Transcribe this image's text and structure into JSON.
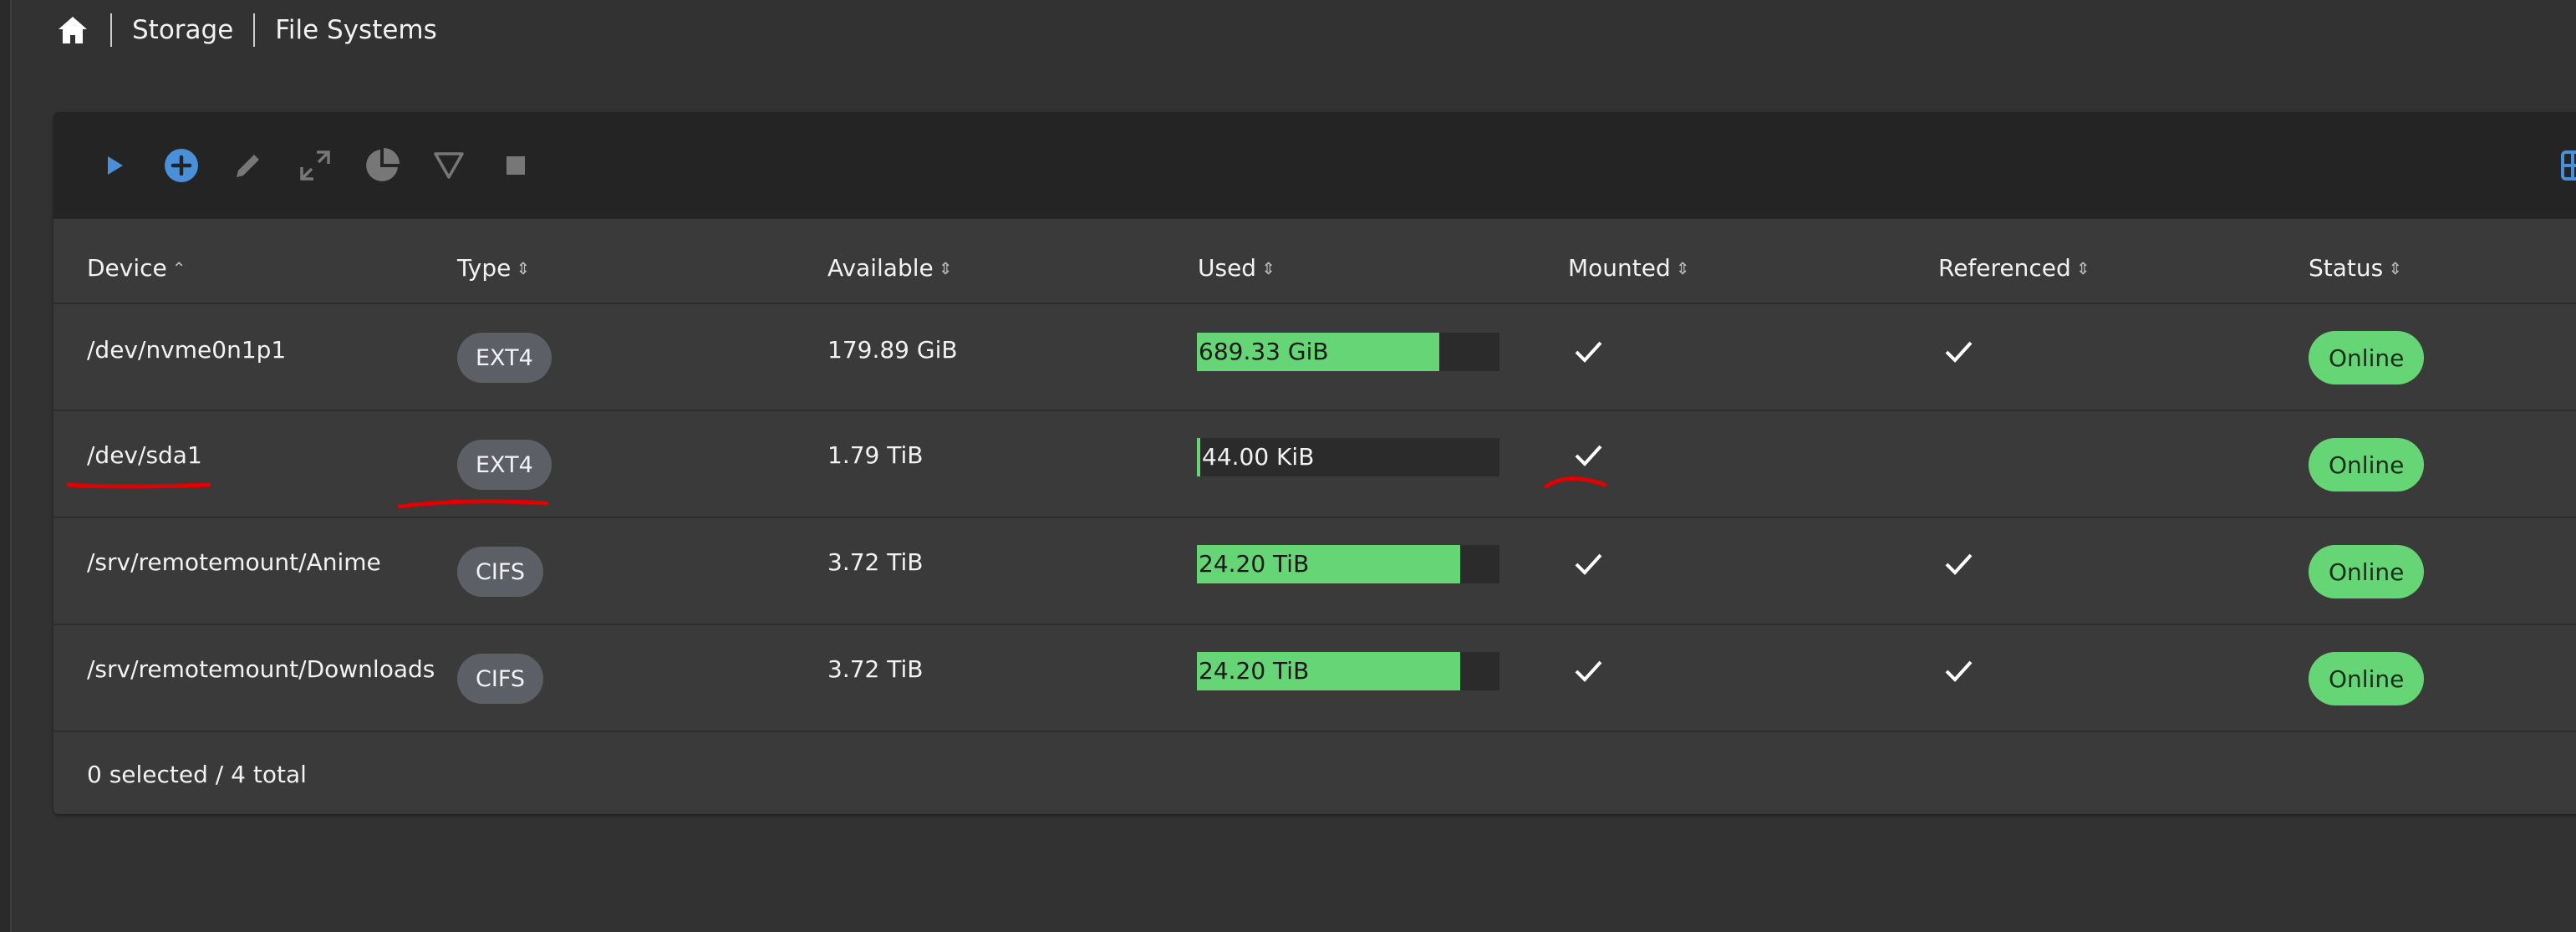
{
  "breadcrumb": {
    "home_icon": "home-icon",
    "items": [
      "Storage",
      "File Systems"
    ]
  },
  "toolbar": {
    "icons": [
      "play-icon",
      "add-circle-icon",
      "edit-icon",
      "expand-icon",
      "pie-chart-icon",
      "filter-icon",
      "stop-icon",
      "table-columns-icon"
    ],
    "accent": "#4a90d9"
  },
  "table": {
    "columns": [
      "Device",
      "Type",
      "Available",
      "Used",
      "Mounted",
      "Referenced",
      "Status"
    ],
    "rows": [
      {
        "device": "/dev/nvme0n1p1",
        "type": "EXT4",
        "available": "179.89 GiB",
        "used": "689.33 GiB",
        "used_fraction": 0.8,
        "mounted": true,
        "referenced": true,
        "status": "Online"
      },
      {
        "device": "/dev/sda1",
        "type": "EXT4",
        "available": "1.79 TiB",
        "used": "44.00 KiB",
        "used_fraction": 0.0,
        "mounted": true,
        "referenced": false,
        "status": "Online"
      },
      {
        "device": "/srv/remotemount/Anime",
        "type": "CIFS",
        "available": "3.72 TiB",
        "used": "24.20 TiB",
        "used_fraction": 0.87,
        "mounted": true,
        "referenced": true,
        "status": "Online"
      },
      {
        "device": "/srv/remotemount/Downloads",
        "type": "CIFS",
        "available": "3.72 TiB",
        "used": "24.20 TiB",
        "used_fraction": 0.87,
        "mounted": true,
        "referenced": true,
        "status": "Online"
      }
    ],
    "footer": "0 selected / 4 total"
  },
  "colors": {
    "usage_bar": "#66d575",
    "status_online": "#66d575",
    "annotation": "#e00000"
  }
}
